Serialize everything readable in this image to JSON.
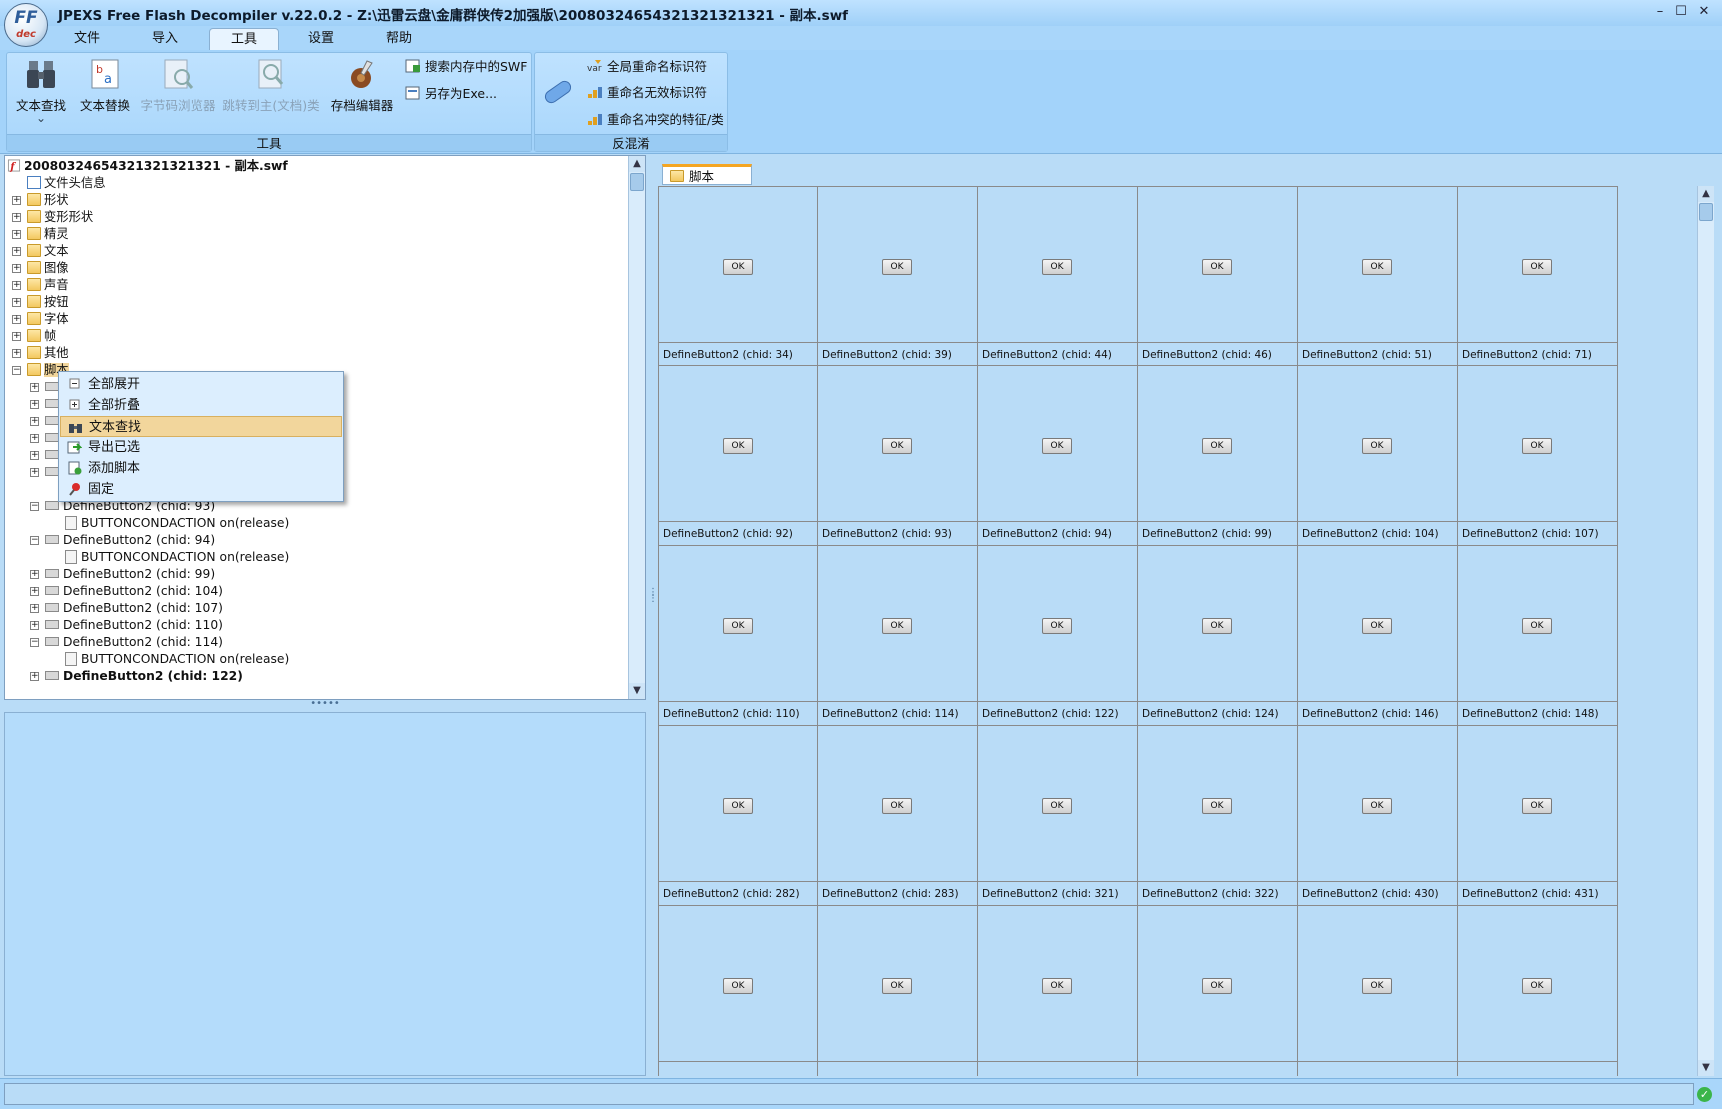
{
  "window": {
    "title": "JPEXS Free Flash Decompiler v.22.0.2 - Z:\\迅雷云盘\\金庸群侠传2加强版\\20080324654321321321321 - 副本.swf",
    "logo_text": "FF",
    "logo_sub": "dec",
    "minimize": "–",
    "maximize": "☐",
    "close": "✕"
  },
  "menu": {
    "tabs": [
      "文件",
      "导入",
      "工具",
      "设置",
      "帮助"
    ],
    "active": "工具"
  },
  "ribbon": {
    "tools_group_label": "工具",
    "deobf_group_label": "反混淆",
    "text_search": "文本查找",
    "text_replace": "文本替换",
    "bytecode_browser": "字节码浏览器",
    "goto_main_class": "跳转到主(文档)类",
    "archive_editor": "存档编辑器",
    "search_memory_swf": "搜索内存中的SWF",
    "save_as_exe": "另存为Exe...",
    "global_rename": "全局重命名标识符",
    "rename_invalid": "重命名无效标识符",
    "rename_colliding": "重命名冲突的特征/类",
    "dropdown_arrow": "⌄"
  },
  "tree": {
    "root": "20080324654321321321321 - 副本.swf",
    "items": [
      "文件头信息",
      "形状",
      "变形形状",
      "精灵",
      "文本",
      "图像",
      "声音",
      "按钮",
      "字体",
      "帧",
      "其他",
      "脚本"
    ],
    "script_children": [
      "BUTTONCONDACTION on(release)",
      "DefineButton2 (chid: 93)",
      "BUTTONCONDACTION on(release)",
      "DefineButton2 (chid: 94)",
      "BUTTONCONDACTION on(release)",
      "DefineButton2 (chid: 99)",
      "DefineButton2 (chid: 104)",
      "DefineButton2 (chid: 107)",
      "DefineButton2 (chid: 110)",
      "DefineButton2 (chid: 114)",
      "BUTTONCONDACTION on(release)",
      "DefineButton2 (chid: 122)"
    ]
  },
  "context_menu": {
    "items": [
      "全部展开",
      "全部折叠",
      "文本查找",
      "导出已选",
      "添加脚本",
      "固定"
    ],
    "highlighted": "文本查找"
  },
  "splitter_dots": "•••••",
  "right_panel": {
    "tab_label": "脚本",
    "ok_label": "OK",
    "cells": [
      "DefineButton2 (chid: 34)",
      "DefineButton2 (chid: 39)",
      "DefineButton2 (chid: 44)",
      "DefineButton2 (chid: 46)",
      "DefineButton2 (chid: 51)",
      "DefineButton2 (chid: 71)",
      "DefineButton2 (chid: 92)",
      "DefineButton2 (chid: 93)",
      "DefineButton2 (chid: 94)",
      "DefineButton2 (chid: 99)",
      "DefineButton2 (chid: 104)",
      "DefineButton2 (chid: 107)",
      "DefineButton2 (chid: 110)",
      "DefineButton2 (chid: 114)",
      "DefineButton2 (chid: 122)",
      "DefineButton2 (chid: 124)",
      "DefineButton2 (chid: 146)",
      "DefineButton2 (chid: 148)",
      "DefineButton2 (chid: 282)",
      "DefineButton2 (chid: 283)",
      "DefineButton2 (chid: 321)",
      "DefineButton2 (chid: 322)",
      "DefineButton2 (chid: 430)",
      "DefineButton2 (chid: 431)",
      "",
      "",
      "",
      "",
      "",
      ""
    ]
  },
  "status": {
    "text": "",
    "ok_icon": "✓"
  },
  "scroll": {
    "up": "▲",
    "down": "▼"
  },
  "colors": {
    "accent": "#a9d6fa",
    "panel": "#b9dcf7",
    "highlight": "#f2d69c"
  }
}
